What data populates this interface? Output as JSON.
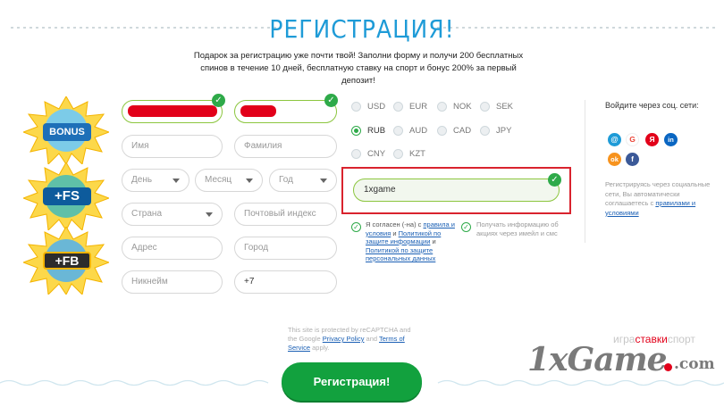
{
  "page": {
    "title": "РЕГИСТРАЦИЯ!",
    "subtitle": "Подарок за регистрацию уже почти твой! Заполни форму и получи 200 бесплатных спинов в течение 10 дней, бесплатную ставку на спорт и бонус 200% за первый депозит!"
  },
  "bonuses": {
    "items": [
      {
        "label": "BONUS",
        "color": "#1e6fb8"
      },
      {
        "label": "+FS",
        "color": "#0d5b9c"
      },
      {
        "label": "+FB",
        "color": "#2c2c2c"
      }
    ]
  },
  "form": {
    "name_placeholder": "Имя",
    "surname_placeholder": "Фамилия",
    "day_placeholder": "День",
    "month_placeholder": "Месяц",
    "year_placeholder": "Год",
    "country_placeholder": "Страна",
    "zip_placeholder": "Почтовый индекс",
    "address_placeholder": "Адрес",
    "city_placeholder": "Город",
    "nickname_placeholder": "Никнейм",
    "phone_value": "+7"
  },
  "currencies": {
    "items": [
      "USD",
      "EUR",
      "NOK",
      "SEK",
      "RUB",
      "AUD",
      "CAD",
      "JPY",
      "CNY",
      "KZT"
    ],
    "selected": "RUB"
  },
  "promo": {
    "value": "1xgame"
  },
  "agree": {
    "prefix": "Я согласен (-на) с ",
    "rules_link": "правила и условия",
    "and1": " и ",
    "privacy_link": "Политикой по защите информации",
    "and2": " и ",
    "personal_link": "Политикой по защите персональных данных",
    "newsletter": "Получать информацию об акциях через имейл и смс"
  },
  "social": {
    "title": "Войдите через соц. сети:",
    "note_text": "Регистрируясь через социальные сети, Вы автоматически соглашаетесь с",
    "note_link": "правилами и условиями",
    "icons": [
      {
        "name": "mail-icon",
        "glyph": "@",
        "color": "#1e9bd7"
      },
      {
        "name": "google-icon",
        "glyph": "G",
        "color": "#ea4335"
      },
      {
        "name": "yandex-icon",
        "glyph": "Я",
        "color": "#e2001a"
      },
      {
        "name": "linkedin-icon",
        "glyph": "in",
        "color": "#0a66c2"
      },
      {
        "name": "odnoklassniki-icon",
        "glyph": "ok",
        "color": "#f7931e"
      },
      {
        "name": "facebook-icon",
        "glyph": "f",
        "color": "#3b5998"
      }
    ]
  },
  "recaptcha": {
    "line1": "This site is protected by reCAPTCHA and the Google ",
    "privacy": "Privacy Policy",
    "and": " and ",
    "terms": "Terms of Service",
    "apply": " apply."
  },
  "submit_label": "Регистрация!",
  "watermark": {
    "top_prefix": "игра",
    "top_red": "ставки",
    "top_suffix": "спорт",
    "brand": "1xGame",
    "domain": ".com"
  }
}
